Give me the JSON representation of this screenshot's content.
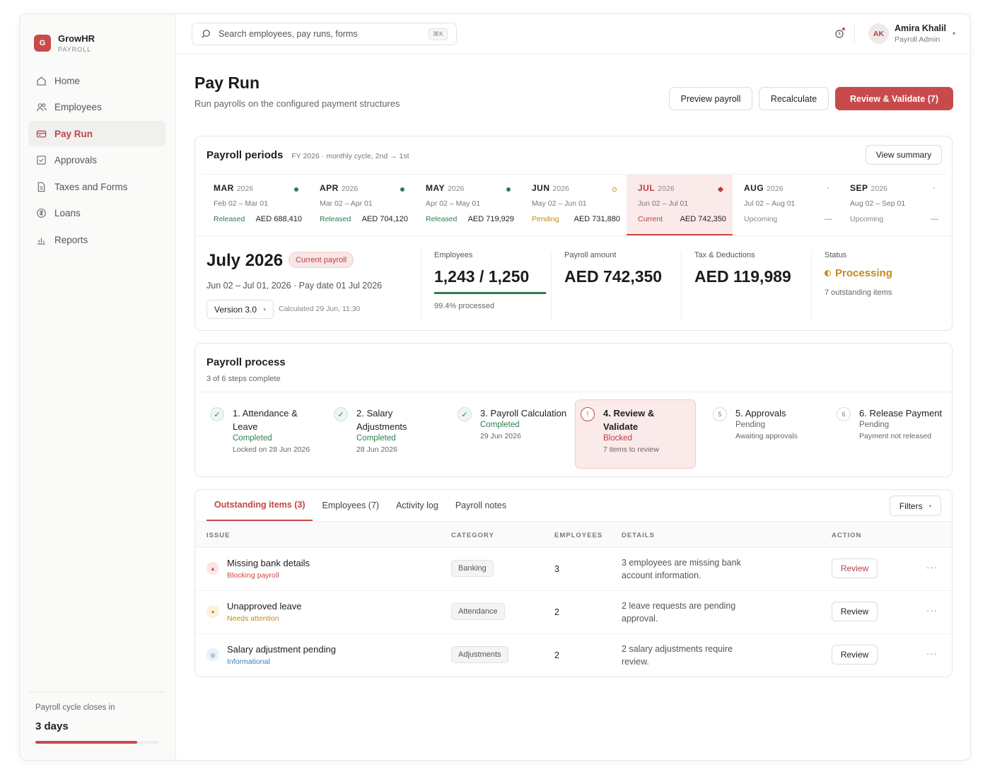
{
  "brand": {
    "logo": "G",
    "name": "GrowHR",
    "sub": "PAYROLL"
  },
  "nav": [
    {
      "label": "Home",
      "icon": "home-icon"
    },
    {
      "label": "Employees",
      "icon": "users-icon"
    },
    {
      "label": "Pay Run",
      "icon": "payrun-icon",
      "active": true
    },
    {
      "label": "Approvals",
      "icon": "check-square-icon"
    },
    {
      "label": "Taxes and Forms",
      "icon": "document-icon"
    },
    {
      "label": "Loans",
      "icon": "coin-icon"
    },
    {
      "label": "Reports",
      "icon": "bar-chart-icon"
    }
  ],
  "sidebar_footer": {
    "label": "Payroll cycle closes in",
    "value": "3 days",
    "progress": 0.83
  },
  "search": {
    "placeholder": "Search employees, pay runs, forms",
    "shortcut": "⌘K"
  },
  "user": {
    "initials": "AK",
    "name": "Amira Khalil",
    "role": "Payroll Admin"
  },
  "header": {
    "title": "Pay Run",
    "subtitle": "Run payrolls on the configured payment structures",
    "preview_label": "Preview payroll",
    "recalculate_label": "Recalculate",
    "review_label": "Review & Validate (7)"
  },
  "periods_card": {
    "title": "Payroll periods",
    "meta": "FY 2026 · monthly cycle, 2nd → 1st",
    "view_summary": "View summary",
    "periods": [
      {
        "month": "MAR",
        "year": "2026",
        "range": "Feb 02 – Mar 01",
        "status": "Released",
        "amount": "AED 688,410"
      },
      {
        "month": "APR",
        "year": "2026",
        "range": "Mar 02 – Apr 01",
        "status": "Released",
        "amount": "AED 704,120"
      },
      {
        "month": "MAY",
        "year": "2026",
        "range": "Apr 02 – May 01",
        "status": "Released",
        "amount": "AED 719,929"
      },
      {
        "month": "JUN",
        "year": "2026",
        "range": "May 02 – Jun 01",
        "status": "Pending",
        "amount": "AED 731,880"
      },
      {
        "month": "JUL",
        "year": "2026",
        "range": "Jun 02 – Jul 01",
        "status": "Current",
        "amount": "AED 742,350"
      },
      {
        "month": "AUG",
        "year": "2026",
        "range": "Jul 02 – Aug 01",
        "status": "Upcoming",
        "amount": "—"
      },
      {
        "month": "SEP",
        "year": "2026",
        "range": "Aug 02 – Sep 01",
        "status": "Upcoming",
        "amount": "—"
      }
    ]
  },
  "summary": {
    "title": "July 2026",
    "badge": "Current payroll",
    "dates": "Jun 02 – Jul 01, 2026 · Pay date 01 Jul 2026",
    "version": "Version 3.0",
    "calculated": "Calculated 29 Jun, 11:30",
    "employees_label": "Employees",
    "employees_value": "1,243 / 1,250",
    "employees_processed": "99.4% processed",
    "employees_progress": 0.994,
    "amount_label": "Payroll amount",
    "amount_value": "AED 742,350",
    "tax_label": "Tax & Deductions",
    "tax_value": "AED 119,989",
    "status_label": "Status",
    "status_value": "Processing",
    "status_sub": "7 outstanding items"
  },
  "process": {
    "title": "Payroll process",
    "sub": "3 of 6 steps complete",
    "steps": [
      {
        "mark": "✓",
        "title": "1. Attendance & Leave",
        "status": "Completed",
        "note": "Locked on 28 Jun 2026"
      },
      {
        "mark": "✓",
        "title": "2. Salary Adjustments",
        "status": "Completed",
        "note": "28 Jun 2026"
      },
      {
        "mark": "✓",
        "title": "3. Payroll Calculation",
        "status": "Completed",
        "note": "29 Jun 2026"
      },
      {
        "mark": "!",
        "title": "4. Review & Validate",
        "status": "Blocked",
        "note": "7 items to review"
      },
      {
        "mark": "5",
        "title": "5. Approvals",
        "status": "Pending",
        "note": "Awaiting approvals"
      },
      {
        "mark": "6",
        "title": "6. Release Payment",
        "status": "Pending",
        "note": "Payment not released"
      }
    ]
  },
  "tabs": [
    "Outstanding items (3)",
    "Employees (7)",
    "Activity log",
    "Payroll notes"
  ],
  "filters_label": "Filters",
  "table": {
    "headers": [
      "ISSUE",
      "CATEGORY",
      "EMPLOYEES",
      "DETAILS",
      "ACTION"
    ],
    "rows": [
      {
        "icon": "▲",
        "name": "Missing bank details",
        "sub": "Blocking payroll",
        "category": "Banking",
        "employees": "3",
        "details": "3 employees are missing bank account information.",
        "action": "Review"
      },
      {
        "icon": "●",
        "name": "Unapproved leave",
        "sub": "Needs attention",
        "category": "Attendance",
        "employees": "2",
        "details": "2 leave requests are pending approval.",
        "action": "Review"
      },
      {
        "icon": "◎",
        "name": "Salary adjustment pending",
        "sub": "Informational",
        "category": "Adjustments",
        "employees": "2",
        "details": "2 salary adjustments require review.",
        "action": "Review"
      }
    ],
    "more": "···"
  },
  "colors": {
    "accent": "#c94a4a",
    "success": "#2f7d4f",
    "warning": "#c58a1a",
    "info": "#3d7fb8"
  }
}
